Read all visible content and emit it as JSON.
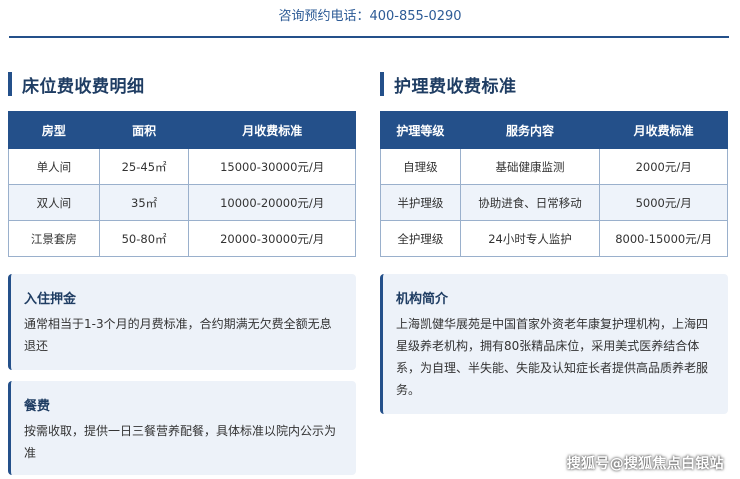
{
  "contact": {
    "text": "咨询预约电话：400-855-0290"
  },
  "bed_section": {
    "title": "床位费收费明细",
    "headers": [
      "房型",
      "面积",
      "月收费标准"
    ],
    "rows": [
      [
        "单人间",
        "25-45㎡",
        "15000-30000元/月"
      ],
      [
        "双人间",
        "35㎡",
        "10000-20000元/月"
      ],
      [
        "江景套房",
        "50-80㎡",
        "20000-30000元/月"
      ]
    ]
  },
  "care_section": {
    "title": "护理费收费标准",
    "headers": [
      "护理等级",
      "服务内容",
      "月收费标准"
    ],
    "rows": [
      [
        "自理级",
        "基础健康监测",
        "2000元/月"
      ],
      [
        "半护理级",
        "协助进食、日常移动",
        "5000元/月"
      ],
      [
        "全护理级",
        "24小时专人监护",
        "8000-15000元/月"
      ]
    ]
  },
  "deposit": {
    "title": "入住押金",
    "body": "通常相当于1-3个月的月费标准，合约期满无欠费全额无息退还"
  },
  "meal": {
    "title": "餐费",
    "body": "按需收取，提供一日三餐营养配餐，具体标准以院内公示为准"
  },
  "intro": {
    "title": "机构简介",
    "body": "上海凯健华展苑是中国首家外资老年康复护理机构，上海四星级养老机构，拥有80张精品床位，采用美式医养结合体系，为自理、半失能、失能及认知症长者提供高品质养老服务。"
  },
  "watermark": {
    "text": "搜狐号@搜狐焦点白银站"
  },
  "colors": {
    "accent": "#24508a",
    "title_text": "#1f3d63",
    "card_bg": "#edf2f9",
    "row_alt": "#eef3fa"
  }
}
